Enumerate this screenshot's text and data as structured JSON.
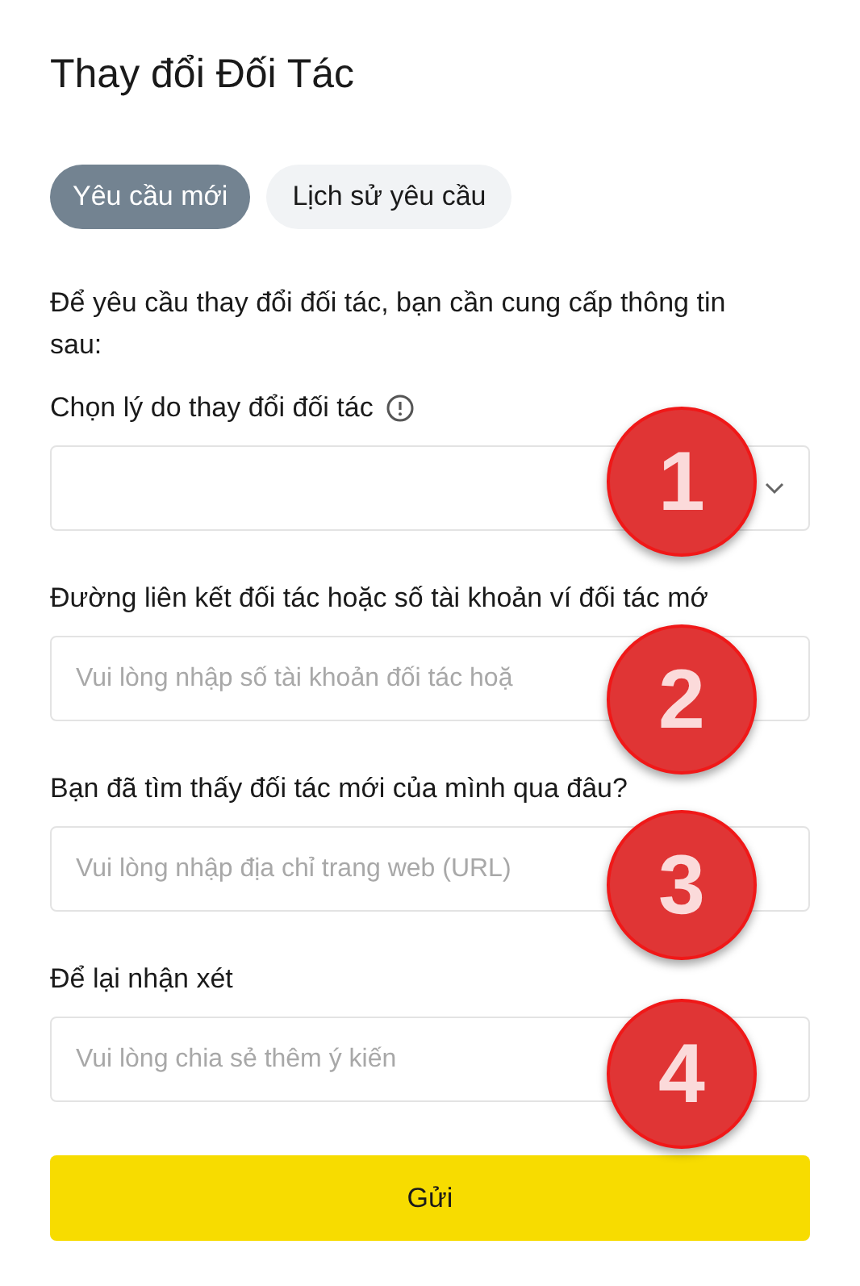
{
  "title": "Thay đổi Đối Tác",
  "tabs": [
    {
      "label": "Yêu cầu mới",
      "selected": true
    },
    {
      "label": "Lịch sử yêu cầu",
      "selected": false
    }
  ],
  "intro": "Để yêu cầu thay đổi đối tác, bạn cần cung cấp thông tin sau:",
  "fields": [
    {
      "kind": "select",
      "label": "Chọn lý do thay đổi đối tác",
      "info": true
    },
    {
      "kind": "text",
      "label": "Đường liên kết đối tác hoặc số tài khoản ví đối tác mớ",
      "placeholder": "Vui lòng nhập số tài khoản đối tác hoặ"
    },
    {
      "kind": "text",
      "label": "Bạn đã tìm thấy đối tác mới của mình qua đâu?",
      "placeholder": "Vui lòng nhập địa chỉ trang web (URL)"
    },
    {
      "kind": "text",
      "label": "Để lại nhận xét",
      "placeholder": "Vui lòng chia sẻ thêm ý kiến"
    }
  ],
  "submit": "Gửi",
  "badges": [
    "1",
    "2",
    "3",
    "4"
  ]
}
